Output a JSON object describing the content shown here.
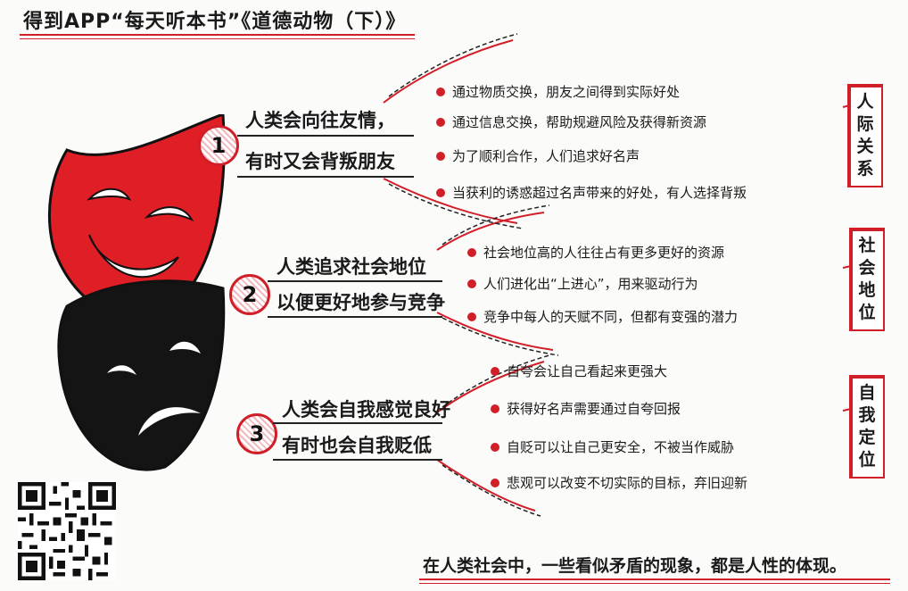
{
  "title": "得到APP“每天听本书”《道德动物（下）》",
  "sections": [
    {
      "number": "1",
      "line1": "人类会向往友情，",
      "line2": "有时又会背叛朋友",
      "bullets": [
        "通过物质交换，朋友之间得到实际好处",
        "通过信息交换，帮助规避风险及获得新资源",
        "为了顺利合作，人们追求好名声",
        "当获利的诱惑超过名声带来的好处，有人选择背叛"
      ],
      "tag": [
        "人",
        "际",
        "关",
        "系"
      ]
    },
    {
      "number": "2",
      "line1": "人类追求社会地位",
      "line2": "以便更好地参与竞争",
      "bullets": [
        "社会地位高的人往往占有更多更好的资源",
        "人们进化出“上进心”，用来驱动行为",
        "竞争中每人的天赋不同，但都有变强的潜力"
      ],
      "tag": [
        "社",
        "会",
        "地",
        "位"
      ]
    },
    {
      "number": "3",
      "line1": "人类会自我感觉良好",
      "line2": "有时也会自我贬低",
      "bullets": [
        "自夸会让自己看起来更强大",
        "获得好名声需要通过自夸回报",
        "自贬可以让自己更安全，不被当作威胁",
        "悲观可以改变不切实际的目标，弃旧迎新"
      ],
      "tag": [
        "自",
        "我",
        "定",
        "位"
      ]
    }
  ],
  "footer": "在人类社会中，一些看似矛盾的现象，都是人性的体现。",
  "colors": {
    "accent": "#d11f2a",
    "ink": "#1a1a1a",
    "mask_black": "#141414"
  },
  "icons": {
    "masks": "comedy-tragedy-masks-icon",
    "qr": "qr-code-icon"
  }
}
